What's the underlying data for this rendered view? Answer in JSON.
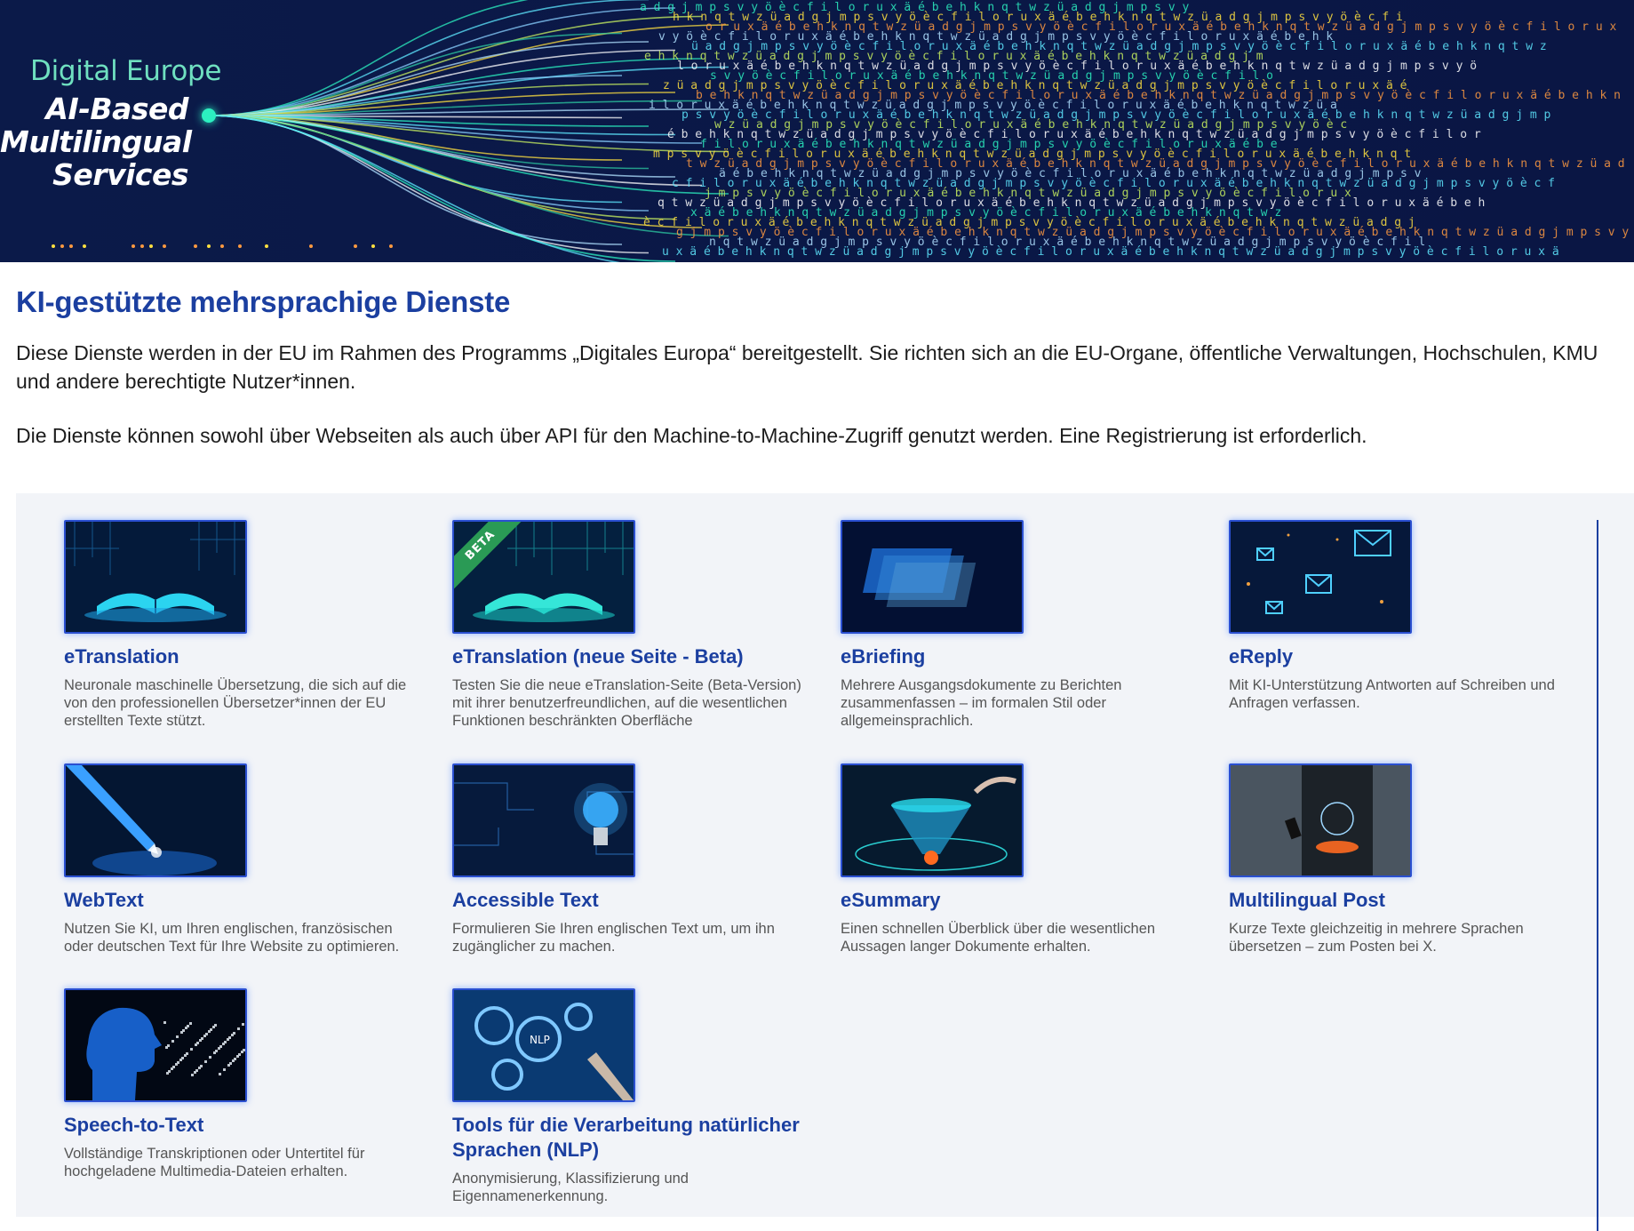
{
  "banner": {
    "brand": "Digital Europe",
    "title_line1": "AI-Based",
    "title_line2": "Multilingual",
    "title_line3": "Services"
  },
  "page": {
    "title": "KI-gestützte mehrsprachige Dienste",
    "lead1": "Diese Dienste werden in der EU im Rahmen des Programms „Digitales Europa“ bereitgestellt. Sie richten sich an die EU-Organe, öffentliche Verwaltungen, Hochschulen, KMU und andere berechtigte Nutzer*innen.",
    "lead2": "Die Dienste können sowohl über Webseiten als auch über API für den Machine-to-Machine-Zugriff genutzt werden. Eine Registrierung ist erforderlich."
  },
  "services": [
    {
      "title": "eTranslation",
      "desc": "Neuronale maschinelle Übersetzung, die sich auf die von den professionellen Übersetzer*innen der EU erstellten Texte stützt.",
      "icon": "open-book-image"
    },
    {
      "title": "eTranslation (neue Seite - Beta)",
      "desc": "Testen Sie die neue eTranslation-Seite (Beta-Version) mit ihrer benutzerfreundlichen, auf die wesentlichen Funktionen beschränkten Oberfläche",
      "badge": "BETA",
      "icon": "open-book-image"
    },
    {
      "title": "eBriefing",
      "desc": "Mehrere Ausgangsdokumente zu Berichten zusammenfassen – im formalen Stil oder allgemeinsprachlich.",
      "icon": "document-stack-image"
    },
    {
      "title": "eReply",
      "desc": "Mit KI-Unterstützung Antworten auf Schreiben und Anfragen verfassen.",
      "icon": "envelopes-image"
    },
    {
      "title": "WebText",
      "desc": "Nutzen Sie KI, um Ihren englischen, französischen oder deutschen Text für Ihre Website zu optimieren.",
      "icon": "pen-image"
    },
    {
      "title": "Accessible Text",
      "desc": "Formulieren Sie Ihren englischen Text um, um ihn zugänglicher zu machen.",
      "icon": "lightbulb-image"
    },
    {
      "title": "eSummary",
      "desc": "Einen schnellen Überblick über die wesentlichen Aussagen langer Dokumente erhalten.",
      "icon": "funnel-image"
    },
    {
      "title": "Multilingual Post",
      "desc": "Kurze Texte gleichzeitig in mehrere Sprachen übersetzen – zum Posten bei X.",
      "icon": "phone-hands-image"
    },
    {
      "title": "Speech-to-Text",
      "desc": "Vollständige Transkriptionen oder Untertitel für hochgeladene Multimedia-Dateien erhalten.",
      "icon": "speaking-head-image"
    },
    {
      "title": "Tools für die Verarbeitung natürlicher Sprachen (NLP)",
      "desc": "Anonymisierung, Klassifizierung und Eigennamenerkennung.",
      "icon": "gears-image"
    }
  ]
}
